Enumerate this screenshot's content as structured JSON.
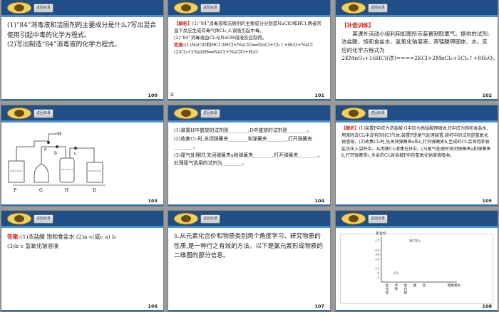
{
  "back_label": "返回目录",
  "slides": {
    "s100": {
      "page": "100",
      "q1": "(1)“84”消毒液和洁厕剂的主要成分是什么?写出混合使用引起中毒的化学方程式。",
      "q2": "(2)写出制造“84”消毒液的化学方程式。"
    },
    "s101": {
      "page": "101",
      "tag": "【解析】",
      "line1": "(1)“84”消毒液和洁厕剂的主要成分分别是NaClO和HCl,两者常温下反应生成有毒气体Cl₂,人误吸引起中毒。",
      "line2": "(2)“84”消毒液由Cl₂与NaOH溶液反应制得。",
      "ans_tag": "答案:",
      "ans1": "(1)NaClO和HCl  2HCl+NaClO══NaCl+Cl₂↑+H₂O+NaCl",
      "ans2": "(2)Cl₂+2NaOH══NaCl+NaClO+H₂O",
      "side_note": "冶"
    },
    "s102": {
      "page": "102",
      "tag": "【补偿训练】",
      "body": "某课外活动小组利用如图所示装置制取氯气。提供的试剂:浓盐酸、饱和食盐水、氢氧化钠溶液、高锰酸钾固体、水。反应的化学方程式为2KMnO₄+16HCl(浓)====2KCl+2MnCl₂+5Cl₂↑+8H₂O。"
    },
    "s103": {
      "page": "103",
      "labels": [
        "M",
        "a",
        "b",
        "c",
        "P",
        "G",
        "H",
        "D"
      ]
    },
    "s104": {
      "page": "104",
      "l1": "(1)装置H中盛放的试剂是________;D中盛放的试剂是________。",
      "l2": "(2)收集Cl₂时,关闭弹簧夹________和弹簧夹________,打开弹簧夹________。",
      "l3": "(3)尾气处理时,关闭弹簧夹a和弹簧夹________,打开弹簧夹________。处理尾气选用的试剂为________。"
    },
    "s105": {
      "page": "105",
      "tag": "【解析】",
      "body": "(1)装置P中应为浓盐酸,G中应为高锰酸钾固体,H中应为饱和食盐水,用来除去Cl₂中混有的HCl气体;装置P是尾气处理装置,袋杆中的试剂是氢氧化钠溶液。(2)收集Cl₂时,先关闭弹簧夹a和c,打开弹簧夹b,生成的Cl₂会将饱和食盐水压入袋杆中。从而使Cl₂收集在H中。(3)尾气处理时关闭弹簧夹a和弹簧夹b,打开弹簧夹c,多余的Cl₂就会被P中的氢氧化钠溶液吸收。"
    },
    "s106": {
      "page": "106",
      "ans_tag": "答案:",
      "ans1": "(1)浓盐酸   饱和食盐水   (2)a   c(或c   a)   b",
      "ans2": "(3)b   c   氢氧化钠溶液"
    },
    "s107": {
      "page": "107",
      "body": "5.从元素化合价和物质类别两个角度学习、研究物质的性质,是一种行之有效的方法。以下是氯元素形成物质的二维图的部分信息。"
    },
    "s108": {
      "page": "108",
      "ylabel": "化合价",
      "yticks": [
        "+7",
        "+5",
        "+4",
        "+3",
        "+1",
        "0",
        "-1"
      ],
      "xlabel": "物质类别",
      "xcats": [
        "氢化物",
        "单质",
        "氧化物",
        "酸",
        "盐"
      ],
      "points": [
        {
          "label": "HClO₄",
          "x": "酸",
          "y": 7
        },
        {
          "label": "Cl₂",
          "x": "单质",
          "y": 0
        }
      ]
    }
  }
}
